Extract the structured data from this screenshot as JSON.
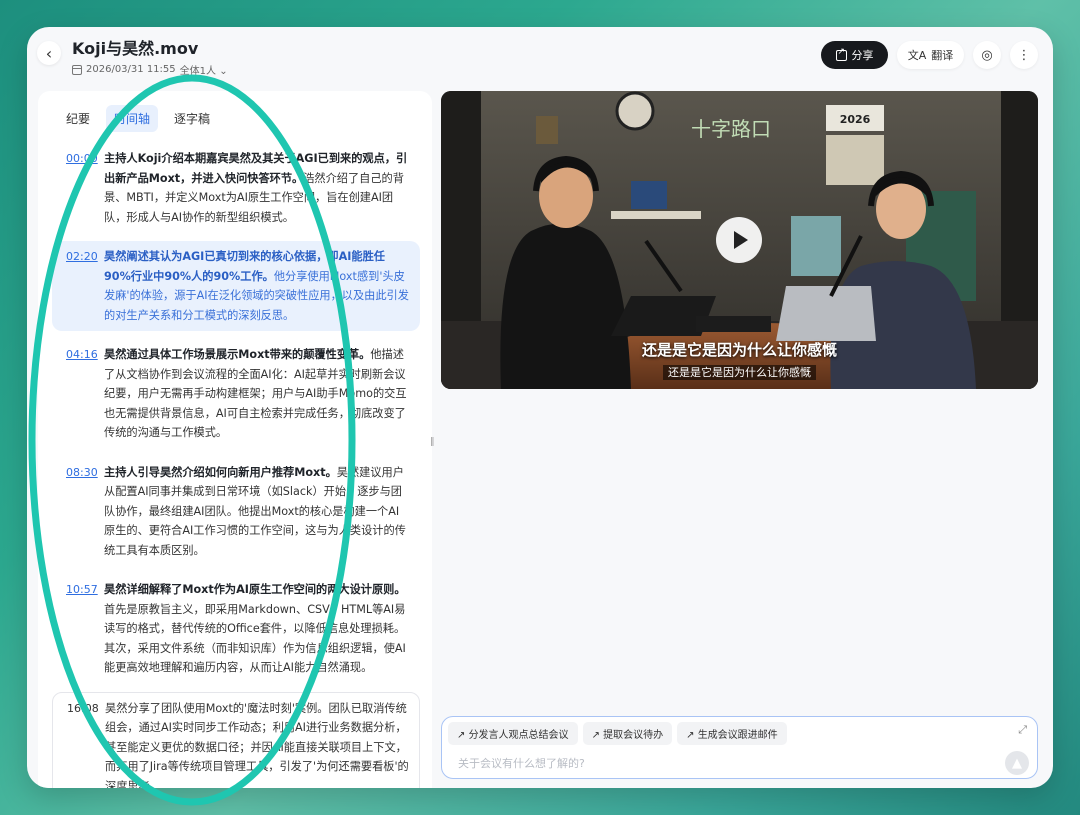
{
  "header": {
    "title": "Koji与昊然.mov",
    "date": "2026/03/31 11:55",
    "participants": "全体1人",
    "share_label": "分享",
    "translate_label": "翻译"
  },
  "tabs": [
    {
      "label": "纪要",
      "active": false
    },
    {
      "label": "时间轴",
      "active": true
    },
    {
      "label": "逐字稿",
      "active": false
    }
  ],
  "timeline": [
    {
      "time": "00:00",
      "title": "主持人Koji介绍本期嘉宾昊然及其关于AGI已到来的观点，引出新产品Moxt，并进入快问快答环节。",
      "body": "浩然介绍了自己的背景、MBTI，并定义Moxt为AI原生工作空间，旨在创建AI团队，形成人与AI协作的新型组织模式。"
    },
    {
      "time": "02:20",
      "title": "昊然阐述其认为AGI已真切到来的核心依据，即AI能胜任90%行业中90%人的90%工作。",
      "body": "他分享使用Moxt感到'头皮发麻'的体验，源于AI在泛化领域的突破性应用，以及由此引发的对生产关系和分工模式的深刻反思。"
    },
    {
      "time": "04:16",
      "title": "昊然通过具体工作场景展示Moxt带来的颠覆性变革。",
      "body": "他描述了从文档协作到会议流程的全面AI化：AI起草并实时刷新会议纪要，用户无需再手动构建框架；用户与AI助手Momo的交互也无需提供背景信息，AI可自主检索并完成任务，彻底改变了传统的沟通与工作模式。"
    },
    {
      "time": "08:30",
      "title": "主持人引导昊然介绍如何向新用户推荐Moxt。",
      "body": "昊然建议用户从配置AI同事并集成到日常环境（如Slack）开始，逐步与团队协作，最终组建AI团队。他提出Moxt的核心是构建一个AI原生的、更符合AI工作习惯的工作空间，这与为人类设计的传统工具有本质区别。"
    },
    {
      "time": "10:57",
      "title": "昊然详细解释了Moxt作为AI原生工作空间的两大设计原则。",
      "body": "首先是原教旨主义，即采用Markdown、CSV、HTML等AI易读写的格式，替代传统的Office套件，以降低信息处理损耗。其次，采用文件系统（而非知识库）作为信息组织逻辑，使AI能更高效地理解和遍历内容，从而让AI能力自然涌现。"
    },
    {
      "time": "16:08",
      "title": "",
      "body": "昊然分享了团队使用Moxt的'魔法时刻'案例。团队已取消传统组会，通过AI实时同步工作动态；利用AI进行业务数据分析，甚至能定义更优的数据口径；并因AI能直接关联项目上下文，而弃用了Jira等传统项目管理工具，引发了'为何还需要看板'的深度思考。"
    }
  ],
  "video": {
    "subtitle_main": "还是是它是因为什么让你感慨",
    "subtitle_secondary": "还是是它是因为什么让你感慨"
  },
  "chat": {
    "chips": [
      "分发言人观点总结会议",
      "提取会议待办",
      "生成会议跟进邮件"
    ],
    "placeholder": "关于会议有什么想了解的?"
  }
}
